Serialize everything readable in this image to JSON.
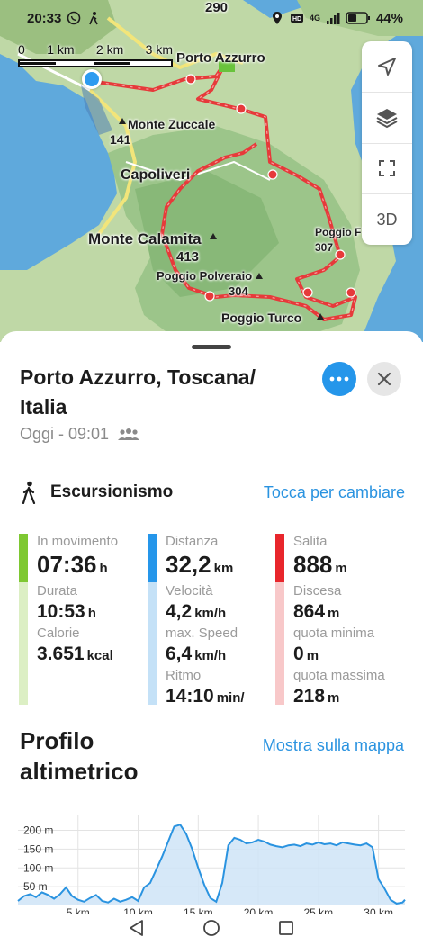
{
  "status_bar": {
    "time": "20:33",
    "battery": "44%",
    "network": "4G"
  },
  "map": {
    "scale_labels": [
      "0",
      "1 km",
      "2 km",
      "3 km"
    ],
    "labels": {
      "porto_azzurro": "Porto Azzurro",
      "monte_zuccale": "Monte Zuccale",
      "monte_zuccale_elev": "141",
      "capoliveri": "Capoliveri",
      "monte_calamita": "Monte Calamita",
      "monte_calamita_elev": "413",
      "poggio_polveraio": "Poggio Polveraio",
      "poggio_polveraio_elev": "304",
      "poggio_f": "Poggio F",
      "poggio_f_elev": "307",
      "poggio_turco": "Poggio Turco",
      "top_elev": "290"
    },
    "controls": {
      "locate_icon": "navigation-arrow-icon",
      "layers_icon": "layers-icon",
      "fullscreen_icon": "fullscreen-icon",
      "three_d_label": "3D"
    }
  },
  "sheet": {
    "title": "Porto Azzurro, Toscana/ Italia",
    "subtitle": "Oggi - 09:01",
    "more_icon": "more-dots-icon",
    "close_icon": "close-icon",
    "activity": {
      "icon": "hiking-icon",
      "label": "Escursionismo",
      "change_link": "Tocca per cambiare"
    },
    "stats": {
      "col1": {
        "color_top": "#7ec832",
        "color_bottom": "#dcefc4",
        "items": [
          {
            "label": "In movimento",
            "value": "07:36",
            "unit": "h"
          },
          {
            "label": "Durata",
            "value": "10:53",
            "unit": "h"
          },
          {
            "label": "Calorie",
            "value": "3.651",
            "unit": "kcal"
          }
        ]
      },
      "col2": {
        "color_top": "#2596ea",
        "color_bottom": "#c4e1f7",
        "items": [
          {
            "label": "Distanza",
            "value": "32,2",
            "unit": "km"
          },
          {
            "label": "Velocità",
            "value": "4,2",
            "unit": "km/h"
          },
          {
            "label": "max. Speed",
            "value": "6,4",
            "unit": "km/h"
          },
          {
            "label": "Ritmo",
            "value": "14:10",
            "unit": "min/"
          }
        ]
      },
      "col3": {
        "color_top": "#e8262c",
        "color_bottom": "#f8c8c9",
        "items": [
          {
            "label": "Salita",
            "value": "888",
            "unit": "m"
          },
          {
            "label": "Discesa",
            "value": "864",
            "unit": "m"
          },
          {
            "label": "quota minima",
            "value": "0",
            "unit": "m"
          },
          {
            "label": "quota massima",
            "value": "218",
            "unit": "m"
          }
        ]
      }
    },
    "profile": {
      "title": "Profilo altimetrico",
      "link": "Mostra sulla mappa"
    }
  },
  "chart_data": {
    "type": "area",
    "title": "Profilo altimetrico",
    "xlabel": "",
    "ylabel": "",
    "x_unit": "km",
    "y_unit": "m",
    "xlim": [
      0,
      32.2
    ],
    "ylim": [
      0,
      230
    ],
    "x_ticks": [
      5,
      10,
      15,
      20,
      25,
      30
    ],
    "x_tick_labels": [
      "5 km",
      "10 km",
      "15 km",
      "20 km",
      "25 km",
      "30 km"
    ],
    "y_ticks": [
      50,
      100,
      150,
      200
    ],
    "y_tick_labels": [
      "50 m",
      "100 m",
      "150 m",
      "200 m"
    ],
    "grid": true,
    "line_color": "#2a93e0",
    "fill_color": "#cfe4f7",
    "x": [
      0,
      0.5,
      1,
      1.5,
      2,
      2.5,
      3,
      3.5,
      4,
      4.5,
      5,
      5.5,
      6,
      6.5,
      7,
      7.5,
      8,
      8.5,
      9,
      9.5,
      10,
      10.5,
      11,
      11.5,
      12,
      12.5,
      13,
      13.5,
      14,
      14.5,
      15,
      15.5,
      16,
      16.5,
      17,
      17.5,
      18,
      18.5,
      19,
      19.5,
      20,
      20.5,
      21,
      21.5,
      22,
      22.5,
      23,
      23.5,
      24,
      24.5,
      25,
      25.5,
      26,
      26.5,
      27,
      27.5,
      28,
      28.5,
      29,
      29.5,
      30,
      30.5,
      31,
      31.5,
      32,
      32.2
    ],
    "y": [
      12,
      25,
      30,
      22,
      35,
      28,
      18,
      30,
      48,
      25,
      15,
      10,
      20,
      28,
      12,
      8,
      18,
      10,
      15,
      22,
      12,
      48,
      60,
      95,
      130,
      170,
      210,
      215,
      190,
      150,
      100,
      55,
      20,
      10,
      60,
      160,
      180,
      175,
      165,
      168,
      175,
      170,
      162,
      158,
      155,
      160,
      162,
      158,
      165,
      162,
      168,
      163,
      165,
      160,
      168,
      165,
      162,
      160,
      165,
      155,
      70,
      45,
      15,
      5,
      8,
      15
    ]
  },
  "nav": {
    "back_icon": "back-triangle-icon",
    "home_icon": "home-circle-icon",
    "recents_icon": "recents-square-icon"
  }
}
